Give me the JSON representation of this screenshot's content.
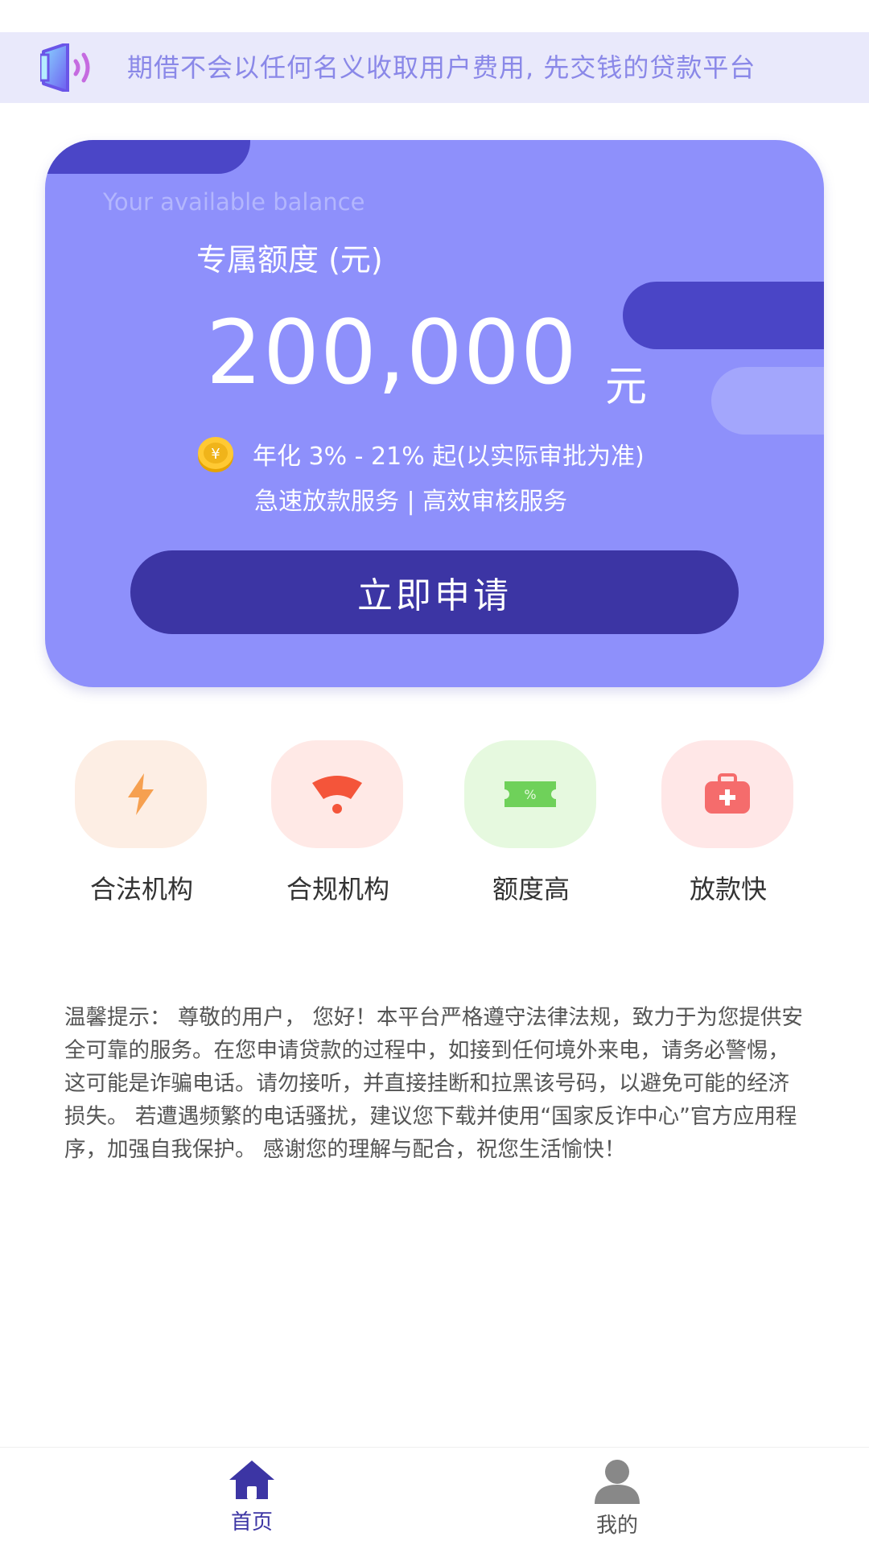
{
  "notice": {
    "text": "期借不会以任何名义收取用户费用, 先交钱的贷款平台",
    "icon": "speaker-icon"
  },
  "card": {
    "en_caption": "Your available balance",
    "label": "专属额度 (元)",
    "amount": "200,000",
    "unit": "元",
    "rate": "年化 3% - 21% 起(以实际审批为准)",
    "services": "急速放款服务 | 高效审核服务",
    "apply_label": "立即申请"
  },
  "features": [
    {
      "label": "合法机构",
      "icon": "lightning-icon"
    },
    {
      "label": "合规机构",
      "icon": "wifi-signal-icon"
    },
    {
      "label": "额度高",
      "icon": "ticket-icon"
    },
    {
      "label": "放款快",
      "icon": "medical-kit-icon"
    }
  ],
  "tip": {
    "text": "温馨提示： 尊敬的用户， 您好！本平台严格遵守法律法规，致力于为您提供安全可靠的服务。在您申请贷款的过程中，如接到任何境外来电，请务必警惕，这可能是诈骗电话。请勿接听，并直接挂断和拉黑该号码，以避免可能的经济损失。 若遭遇频繁的电话骚扰，建议您下载并使用“国家反诈中心”官方应用程序，加强自我保护。 感谢您的理解与配合，祝您生活愉快！"
  },
  "nav": {
    "home_label": "首页",
    "mine_label": "我的"
  },
  "colors": {
    "card_bg": "#8e90fb",
    "button_bg": "#3c35a4",
    "accent": "#4a45c6",
    "nav_active": "#3c35a4",
    "nav_inactive": "#888888"
  }
}
